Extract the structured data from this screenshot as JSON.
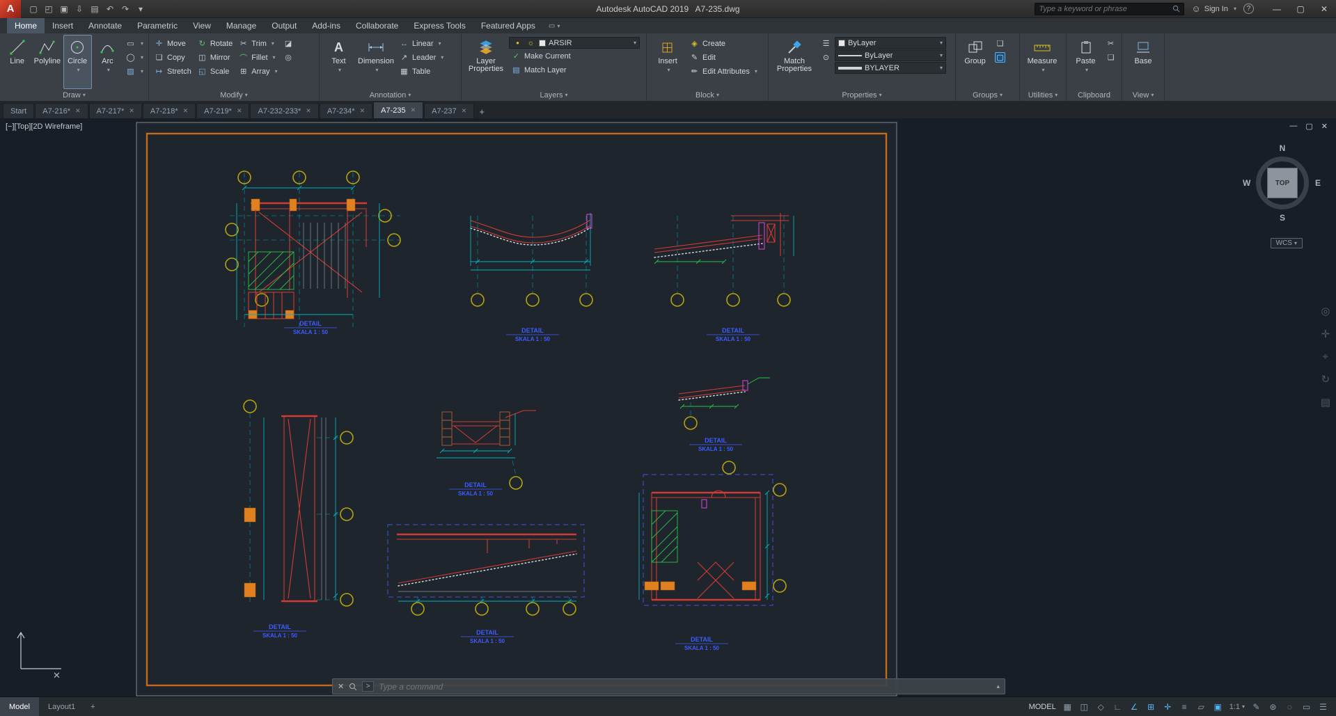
{
  "titlebar": {
    "app_title": "Autodesk AutoCAD 2019   A7-235.dwg",
    "search_placeholder": "Type a keyword or phrase",
    "sign_in_label": "Sign In",
    "logo_letter": "A"
  },
  "qat_icons": [
    {
      "name": "new-file",
      "glyph": "▢"
    },
    {
      "name": "open-file",
      "glyph": "◰"
    },
    {
      "name": "save-file",
      "glyph": "▣"
    },
    {
      "name": "save-as",
      "glyph": "⇩"
    },
    {
      "name": "plot",
      "glyph": "▤"
    },
    {
      "name": "undo",
      "glyph": "↶"
    },
    {
      "name": "redo",
      "glyph": "↷"
    },
    {
      "name": "qat-menu",
      "glyph": "▾"
    }
  ],
  "ribbon_tabs": [
    {
      "label": "Home",
      "active": true
    },
    {
      "label": "Insert"
    },
    {
      "label": "Annotate"
    },
    {
      "label": "Parametric"
    },
    {
      "label": "View"
    },
    {
      "label": "Manage"
    },
    {
      "label": "Output"
    },
    {
      "label": "Add-ins"
    },
    {
      "label": "Collaborate"
    },
    {
      "label": "Express Tools"
    },
    {
      "label": "Featured Apps"
    }
  ],
  "panels": {
    "draw": {
      "title": "Draw",
      "line": "Line",
      "polyline": "Polyline",
      "circle": "Circle",
      "arc": "Arc"
    },
    "modify": {
      "title": "Modify",
      "move": "Move",
      "rotate": "Rotate",
      "trim": "Trim",
      "copy": "Copy",
      "mirror": "Mirror",
      "fillet": "Fillet",
      "stretch": "Stretch",
      "scale": "Scale",
      "array": "Array"
    },
    "annotation": {
      "title": "Annotation",
      "text": "Text",
      "dimension": "Dimension",
      "linear": "Linear",
      "leader": "Leader",
      "table": "Table"
    },
    "layers": {
      "title": "Layers",
      "layer_properties": "Layer Properties",
      "current_layer": "ARSIR",
      "make_current": "Make Current",
      "match_layer": "Match Layer"
    },
    "block": {
      "title": "Block",
      "insert": "Insert",
      "create": "Create",
      "edit": "Edit",
      "edit_attributes": "Edit Attributes"
    },
    "properties": {
      "title": "Properties",
      "match_properties": "Match Properties",
      "color": "ByLayer",
      "linetype": "ByLayer",
      "lineweight": "BYLAYER"
    },
    "groups": {
      "title": "Groups",
      "group": "Group"
    },
    "utilities": {
      "title": "Utilities",
      "measure": "Measure"
    },
    "clipboard": {
      "title": "Clipboard",
      "paste": "Paste"
    },
    "view": {
      "title": "View",
      "base": "Base"
    }
  },
  "icons": {
    "move": "✛",
    "rotate": "↻",
    "trim": "✂",
    "copy": "❏",
    "mirror": "◫",
    "fillet": "⌒",
    "stretch": "↦",
    "scale": "◱",
    "array": "⊞",
    "erase": "◪",
    "explode": "◎",
    "linear": "↔",
    "leader": "↗",
    "table": "▦",
    "create": "◈",
    "edit": "✎",
    "edit_attributes": "✏",
    "make_current": "✓",
    "match_layer": "▤",
    "rectangle": "▭",
    "ellipse": "◯",
    "hatch": "▨",
    "bulb": "●",
    "sun": "☼",
    "cut": "✂",
    "pin": "⊙",
    "id_point": "⌖",
    "list": "☰",
    "person": "☺",
    "help": "?",
    "close": "✕",
    "minimize": "—",
    "maximize": "▢",
    "plus": "+",
    "history_up": "▴"
  },
  "file_tabs": [
    {
      "label": "Start"
    },
    {
      "label": "A7-216*"
    },
    {
      "label": "A7-217*"
    },
    {
      "label": "A7-218*"
    },
    {
      "label": "A7-219*"
    },
    {
      "label": "A7-232-233*"
    },
    {
      "label": "A7-234*"
    },
    {
      "label": "A7-235",
      "active": true
    },
    {
      "label": "A7-237"
    }
  ],
  "viewport": {
    "controls_label": "[−][Top][2D Wireframe]",
    "viewcube": {
      "north": "N",
      "south": "S",
      "east": "E",
      "west": "W",
      "top_face": "TOP"
    },
    "wcs_label": "WCS"
  },
  "drawing": {
    "captions": [
      {
        "title": "DETAIL",
        "scale": "SKALA 1 : 50"
      },
      {
        "title": "DETAIL",
        "scale": "SKALA 1 : 50"
      },
      {
        "title": "DETAIL",
        "scale": "SKALA 1 : 50"
      },
      {
        "title": "DETAIL",
        "scale": "SKALA 1 : 50"
      },
      {
        "title": "DETAIL",
        "scale": "SKALA 1 : 50"
      },
      {
        "title": "DETAIL",
        "scale": "SKALA 1 : 50"
      },
      {
        "title": "DETAIL",
        "scale": "SKALA 1 : 50"
      },
      {
        "title": "DETAIL",
        "scale": "SKALA 1 : 50"
      }
    ]
  },
  "command_bar": {
    "prompt": ">",
    "placeholder": "Type a command"
  },
  "layout_bar": {
    "model": "Model",
    "layout1": "Layout1",
    "add_label": "+"
  },
  "status_bar": {
    "model_label": "MODEL",
    "scale_label": "1:1",
    "icons": [
      {
        "name": "grid-display",
        "glyph": "▦",
        "on": false
      },
      {
        "name": "snap-mode",
        "glyph": "◫",
        "on": false
      },
      {
        "name": "infer-constraints",
        "glyph": "◇",
        "on": false
      },
      {
        "name": "ortho-mode",
        "glyph": "∟",
        "on": false
      },
      {
        "name": "polar-tracking",
        "glyph": "∠",
        "on": true
      },
      {
        "name": "object-snap",
        "glyph": "⊞",
        "on": true
      },
      {
        "name": "object-snap-tracking",
        "glyph": "✛",
        "on": true
      },
      {
        "name": "lineweight",
        "glyph": "≡",
        "on": false
      },
      {
        "name": "transparency",
        "glyph": "▱",
        "on": false
      },
      {
        "name": "selection-cycling",
        "glyph": "▣",
        "on": true
      },
      {
        "name": "annotation-visibility",
        "glyph": "✎",
        "on": false
      },
      {
        "name": "workspace-switching",
        "glyph": "⊛",
        "on": false
      },
      {
        "name": "isolate-objects",
        "glyph": "◌",
        "on": false
      },
      {
        "name": "clean-screen",
        "glyph": "▭",
        "on": false
      },
      {
        "name": "customization",
        "glyph": "☰",
        "on": false
      }
    ]
  },
  "nav_icons": [
    {
      "name": "navigation-wheel",
      "glyph": "◎"
    },
    {
      "name": "pan",
      "glyph": "✛"
    },
    {
      "name": "zoom",
      "glyph": "⌖"
    },
    {
      "name": "orbit",
      "glyph": "↻"
    },
    {
      "name": "showmotion",
      "glyph": "▤"
    }
  ],
  "colors": {
    "accent_blue": "#55b4f2",
    "cad_red": "#d23b33",
    "cad_cyan": "#00b4c0",
    "cad_green": "#27c24a",
    "cad_yellow": "#b5a40f",
    "cad_orange": "#e0801f",
    "cad_magenta": "#cf42cf",
    "cad_label_blue": "#3e5cff"
  }
}
